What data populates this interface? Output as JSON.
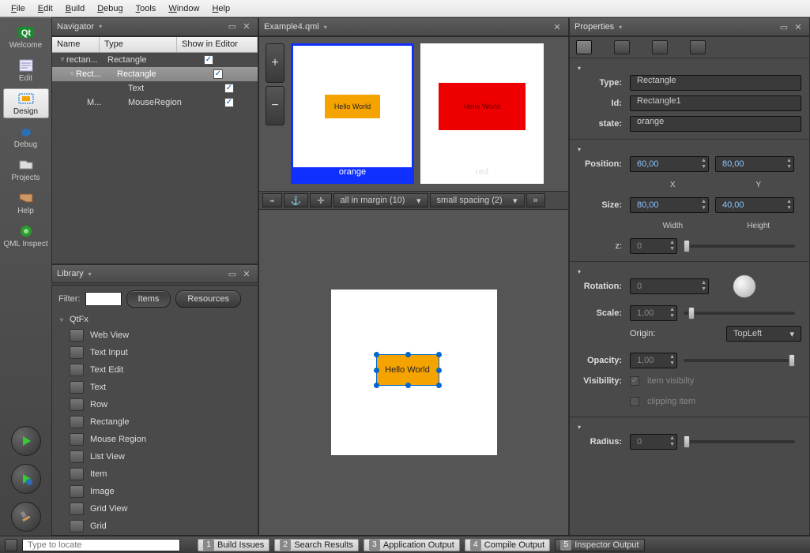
{
  "menu": [
    "File",
    "Edit",
    "Build",
    "Debug",
    "Tools",
    "Window",
    "Help"
  ],
  "sidebar": {
    "items": [
      {
        "label": "Welcome"
      },
      {
        "label": "Edit"
      },
      {
        "label": "Design"
      },
      {
        "label": "Debug"
      },
      {
        "label": "Projects"
      },
      {
        "label": "Help"
      },
      {
        "label": "QML Inspect"
      }
    ]
  },
  "navigator": {
    "title": "Navigator",
    "columns": {
      "name": "Name",
      "type": "Type",
      "show": "Show in Editor"
    },
    "rows": [
      {
        "name": "rectan...",
        "type": "Rectangle",
        "checked": true,
        "indent": 0,
        "twisty": "▿"
      },
      {
        "name": "Rect...",
        "type": "Rectangle",
        "checked": true,
        "indent": 1,
        "twisty": "▿",
        "selected": true
      },
      {
        "name": "",
        "type": "Text",
        "checked": true,
        "indent": 2
      },
      {
        "name": "M...",
        "type": "MouseRegion",
        "checked": true,
        "indent": 2
      }
    ]
  },
  "library": {
    "title": "Library",
    "filter_label": "Filter:",
    "tabs": {
      "items": "Items",
      "resources": "Resources"
    },
    "group": "QtFx",
    "items": [
      "Web View",
      "Text Input",
      "Text Edit",
      "Text",
      "Row",
      "Rectangle",
      "Mouse Region",
      "List View",
      "Item",
      "Image",
      "Grid View",
      "Grid"
    ]
  },
  "document": {
    "title": "Example4.qml"
  },
  "states": {
    "orange": {
      "caption": "orange",
      "text": "Hello World"
    },
    "red": {
      "caption": "red",
      "text": "Hello World"
    }
  },
  "layoutbar": {
    "margin": "all in margin (10)",
    "spacing": "small spacing (2)"
  },
  "canvas": {
    "item_text": "Hello World"
  },
  "properties": {
    "title": "Properties",
    "type_label": "Type:",
    "type_value": "Rectangle",
    "id_label": "Id:",
    "id_value": "Rectangle1",
    "state_label": "state:",
    "state_value": "orange",
    "position_label": "Position:",
    "x": "60,00",
    "y": "80,00",
    "x_label": "X",
    "y_label": "Y",
    "size_label": "Size:",
    "w": "80,00",
    "h": "40,00",
    "w_label": "Width",
    "h_label": "Height",
    "z_label": "z:",
    "z": "0",
    "rotation_label": "Rotation:",
    "rotation": "0",
    "scale_label": "Scale:",
    "scale": "1,00",
    "origin_label": "Origin:",
    "origin": "TopLeft",
    "opacity_label": "Opacity:",
    "opacity": "1,00",
    "visibility_label": "Visibility:",
    "vis_item": "item visibilty",
    "vis_clip": "clipping item",
    "radius_label": "Radius:",
    "radius": "0"
  },
  "status": {
    "locate_placeholder": "Type to locate",
    "tabs": [
      {
        "n": "1",
        "label": "Build Issues"
      },
      {
        "n": "2",
        "label": "Search Results"
      },
      {
        "n": "3",
        "label": "Application Output"
      },
      {
        "n": "4",
        "label": "Compile Output"
      },
      {
        "n": "5",
        "label": "Inspector Output"
      }
    ]
  }
}
